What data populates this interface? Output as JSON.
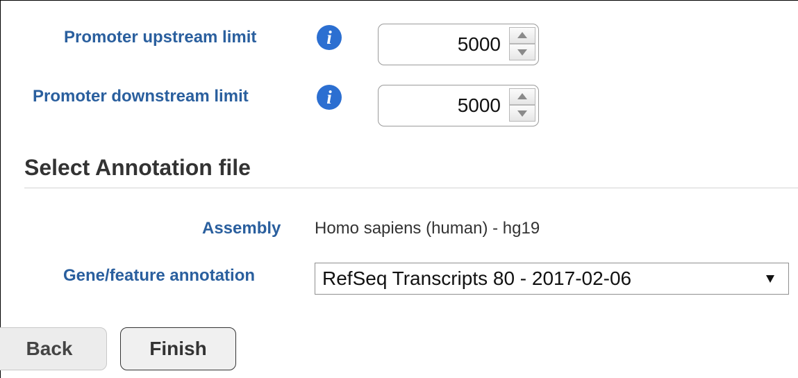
{
  "form": {
    "promoter_upstream": {
      "label": "Promoter upstream limit",
      "value": "5000",
      "info_icon": "info-icon"
    },
    "promoter_downstream": {
      "label": "Promoter downstream limit",
      "value": "5000",
      "info_icon": "info-icon"
    }
  },
  "annotation_section": {
    "title": "Select Annotation file",
    "assembly": {
      "label": "Assembly",
      "value": "Homo sapiens (human) - hg19"
    },
    "gene_feature": {
      "label": "Gene/feature annotation",
      "selected": "RefSeq Transcripts 80 - 2017-02-06"
    }
  },
  "buttons": {
    "back": "Back",
    "finish": "Finish"
  },
  "colors": {
    "label_blue": "#2a5f9e",
    "info_icon_blue": "#2c6fd1",
    "heading": "#333333"
  }
}
